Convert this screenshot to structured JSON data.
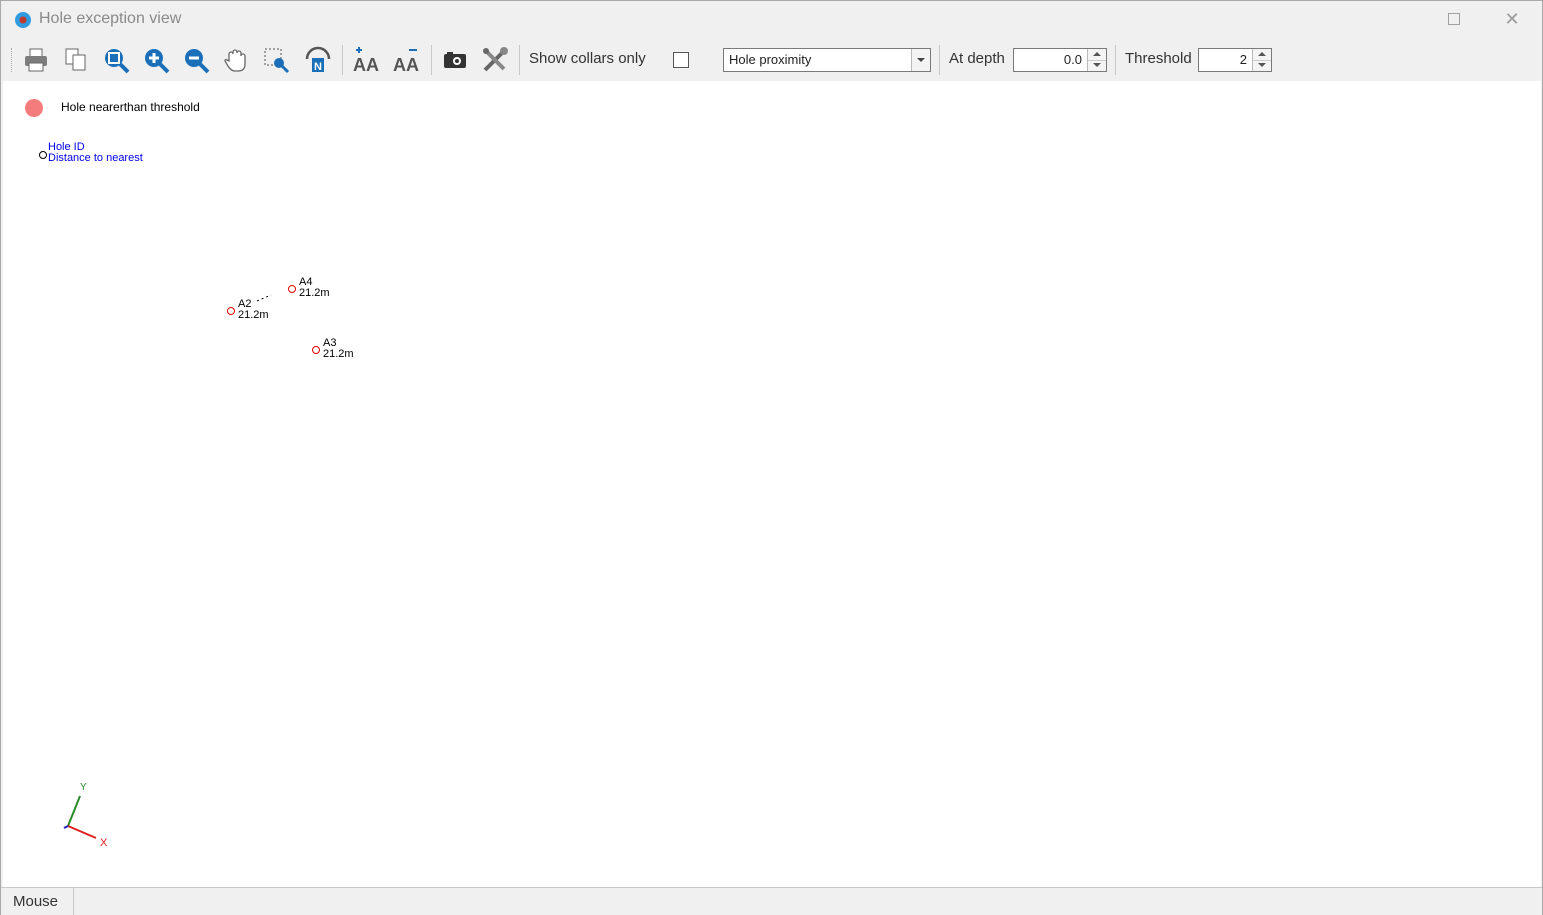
{
  "window": {
    "title": "Hole exception view"
  },
  "toolbar": {
    "show_collars_label": "Show collars only",
    "show_collars_checked": false,
    "mode_select_value": "Hole proximity",
    "at_depth_label": "At depth",
    "at_depth_value": "0.0",
    "threshold_label": "Threshold",
    "threshold_value": "2",
    "icons": [
      "print-icon",
      "copy-icon",
      "zoom-extents-icon",
      "zoom-in-icon",
      "zoom-out-icon",
      "pan-hand-icon",
      "zoom-window-icon",
      "north-arrow-icon",
      "increase-font-icon",
      "decrease-font-icon",
      "camera-icon",
      "settings-tools-icon"
    ]
  },
  "legend": {
    "item_label": "Hole nearerthan threshold",
    "item_color": "#f47c7c",
    "key_line1": "Hole ID",
    "key_line2": "Distance to nearest"
  },
  "holes": [
    {
      "id": "A4",
      "distance": "21.2m"
    },
    {
      "id": "A2",
      "distance": "21.2m"
    },
    {
      "id": "A3",
      "distance": "21.2m"
    }
  ],
  "axes": {
    "x_label": "X",
    "y_label": "Y"
  },
  "status": {
    "mode": "Mouse"
  }
}
